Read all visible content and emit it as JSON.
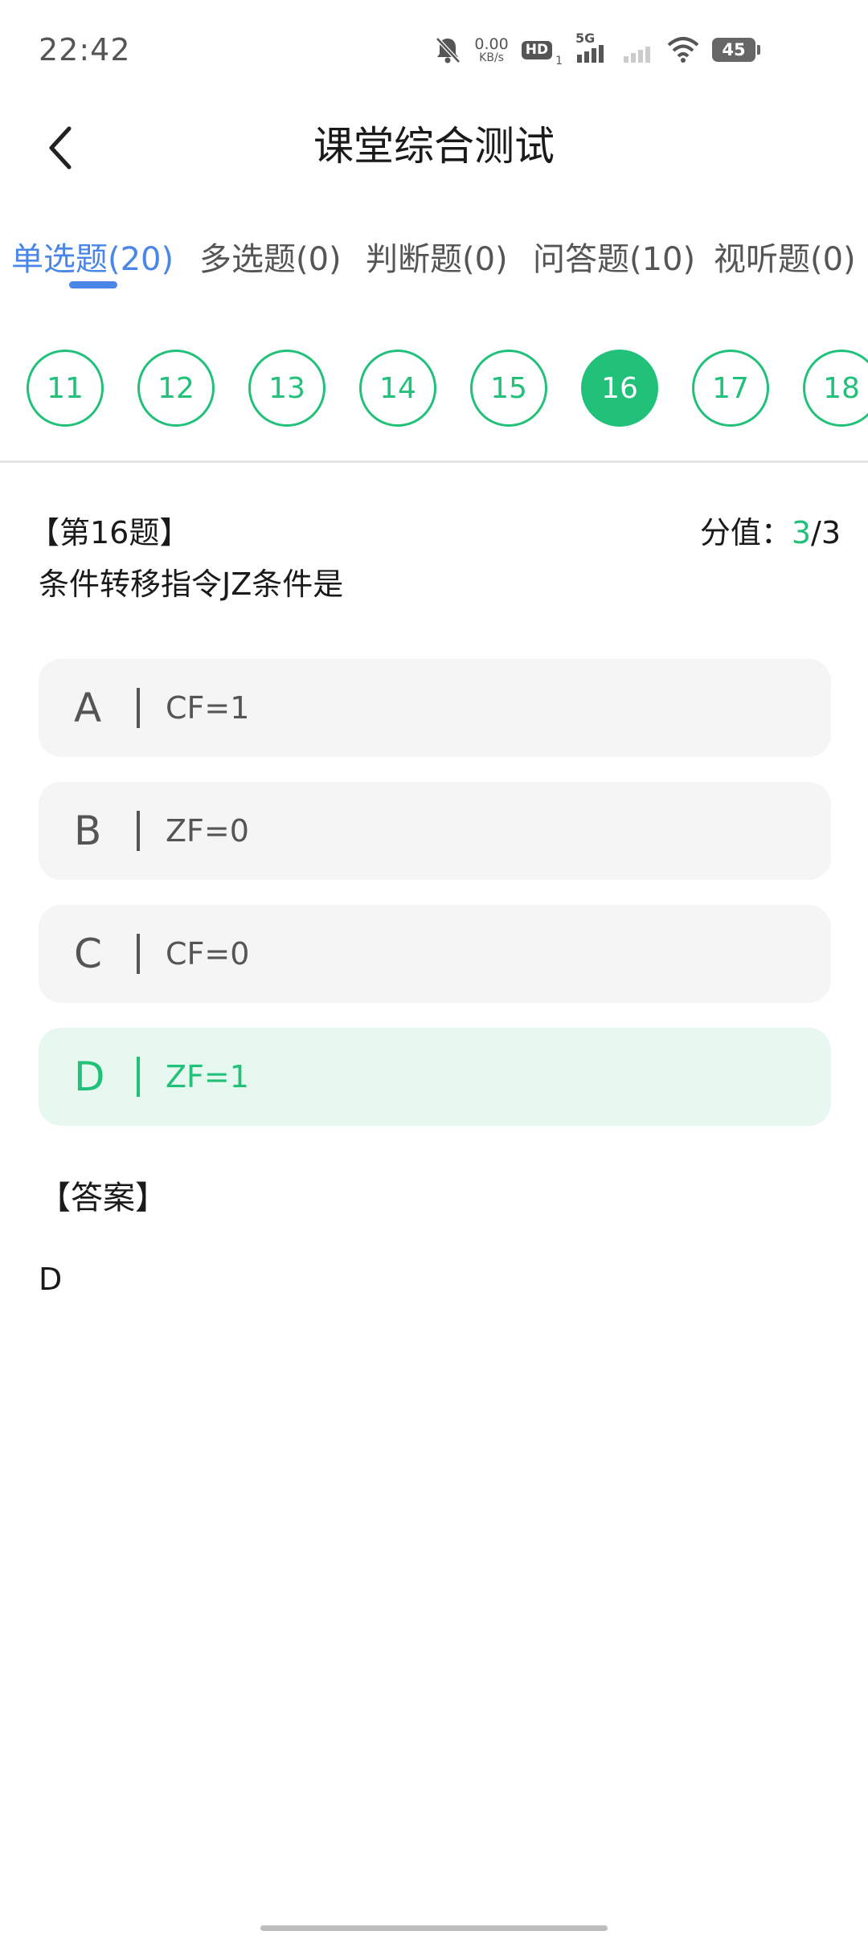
{
  "status_bar": {
    "time": "22:42",
    "net_speed_value": "0.00",
    "net_speed_unit": "KB/s",
    "hd_label": "HD",
    "sim_index": "1",
    "network_type": "5G",
    "battery_level": "45",
    "icons": [
      "mute-bell-icon",
      "signal-icon",
      "signal-weak-icon",
      "wifi-icon",
      "battery-icon"
    ]
  },
  "header": {
    "title": "课堂综合测试",
    "back_icon": "chevron-left-icon"
  },
  "tabs": [
    {
      "label": "单选题(20)",
      "active": true
    },
    {
      "label": "多选题(0)",
      "active": false
    },
    {
      "label": "判断题(0)",
      "active": false
    },
    {
      "label": "问答题(10)",
      "active": false
    },
    {
      "label": "视听题(0)",
      "active": false
    }
  ],
  "question_numbers": [
    "11",
    "12",
    "13",
    "14",
    "15",
    "16",
    "17",
    "18"
  ],
  "current_question": "16",
  "question": {
    "number_label": "【第16题】",
    "score_label": "分值：",
    "score_value": "3",
    "score_total": "/3",
    "text": "条件转移指令JZ条件是"
  },
  "options": [
    {
      "letter": "A",
      "text": "CF=1",
      "selected": false
    },
    {
      "letter": "B",
      "text": "ZF=0",
      "selected": false
    },
    {
      "letter": "C",
      "text": "CF=0",
      "selected": false
    },
    {
      "letter": "D",
      "text": "ZF=1",
      "selected": true
    }
  ],
  "answer": {
    "label": "【答案】",
    "value": "D"
  },
  "colors": {
    "accent_green": "#21c17a",
    "tab_active_blue": "#4a86e8",
    "option_bg": "#f5f5f5",
    "option_selected_bg": "#e6f8f0"
  }
}
